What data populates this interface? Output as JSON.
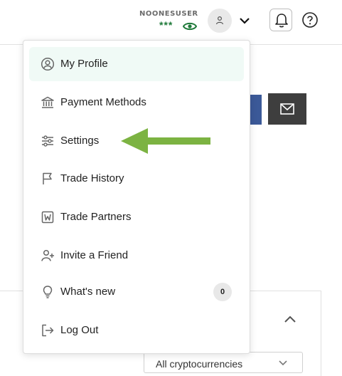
{
  "header": {
    "username": "NOONESUSER",
    "balance_masked": "***",
    "icons": [
      "eye-icon",
      "user-icon",
      "chevron-down-icon",
      "bell-icon",
      "help-icon"
    ]
  },
  "menu": {
    "items": [
      {
        "label": "My Profile",
        "icon": "user-circle-icon",
        "active": true
      },
      {
        "label": "Payment Methods",
        "icon": "bank-icon"
      },
      {
        "label": "Settings",
        "icon": "sliders-icon"
      },
      {
        "label": "Trade History",
        "icon": "flag-icon"
      },
      {
        "label": "Trade Partners",
        "icon": "partners-icon"
      },
      {
        "label": "Invite a Friend",
        "icon": "add-user-icon"
      },
      {
        "label": "What's new",
        "icon": "lightbulb-icon",
        "badge": "0"
      },
      {
        "label": "Log Out",
        "icon": "logout-icon"
      }
    ]
  },
  "background": {
    "select_value": "All cryptocurrencies"
  },
  "colors": {
    "accent_green": "#1f7a3a",
    "active_bg": "#f0faf6",
    "annotation_arrow": "#7cb342",
    "facebook_blue": "#3b5998",
    "mail_button": "#3e3e3e"
  }
}
